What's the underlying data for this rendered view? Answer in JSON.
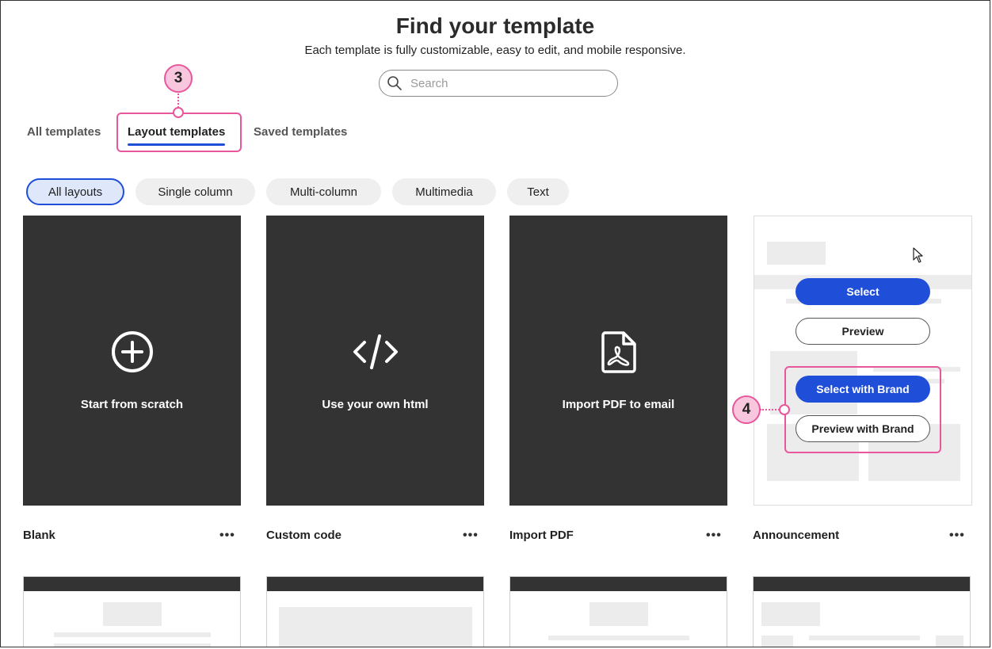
{
  "header": {
    "title": "Find your template",
    "subtitle": "Each template is fully customizable, easy to edit, and mobile responsive."
  },
  "search": {
    "placeholder": "Search",
    "value": ""
  },
  "tabs": [
    {
      "label": "All templates",
      "active": false
    },
    {
      "label": "Layout templates",
      "active": true
    },
    {
      "label": "Saved templates",
      "active": false
    }
  ],
  "filters": [
    {
      "label": "All layouts",
      "active": true
    },
    {
      "label": "Single column",
      "active": false
    },
    {
      "label": "Multi-column",
      "active": false
    },
    {
      "label": "Multimedia",
      "active": false
    },
    {
      "label": "Text",
      "active": false
    }
  ],
  "cards": [
    {
      "label": "Start from scratch",
      "name": "Blank",
      "icon": "plus-circle-icon"
    },
    {
      "label": "Use your own html",
      "name": "Custom code",
      "icon": "code-icon"
    },
    {
      "label": "Import PDF to email",
      "name": "Import PDF",
      "icon": "pdf-file-icon"
    },
    {
      "name": "Announcement"
    }
  ],
  "template_actions": {
    "select": "Select",
    "preview": "Preview",
    "select_brand": "Select with Brand",
    "preview_brand": "Preview with Brand"
  },
  "more_label": "•••",
  "callouts": {
    "step3": "3",
    "step4": "4"
  },
  "colors": {
    "accent": "#1f4ed8",
    "callout": "#e8579b",
    "card_bg": "#333333"
  }
}
